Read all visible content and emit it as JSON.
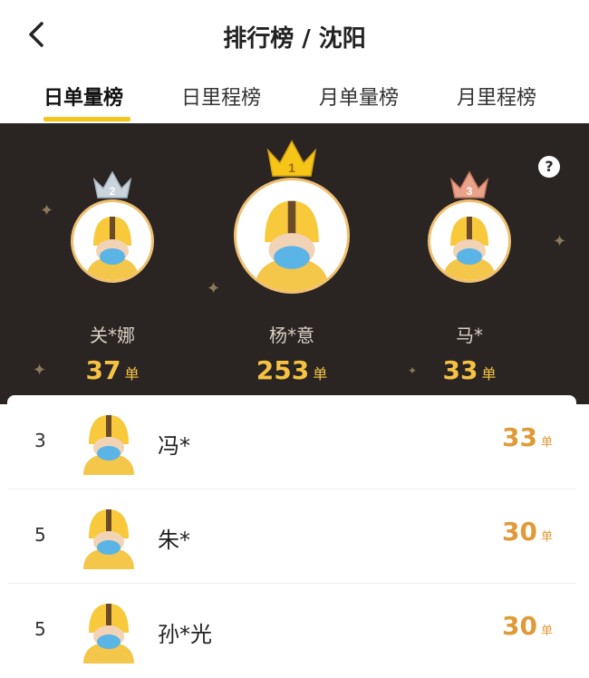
{
  "header": {
    "title": "排行榜 / 沈阳",
    "back_icon": "chevron-left-icon"
  },
  "tabs": [
    {
      "label": "日单量榜",
      "active": true
    },
    {
      "label": "日里程榜",
      "active": false
    },
    {
      "label": "月单量榜",
      "active": false
    },
    {
      "label": "月里程榜",
      "active": false
    }
  ],
  "podium": {
    "help_icon": "?",
    "first": {
      "rank": "1",
      "name": "杨*意",
      "count": "253",
      "unit": "单"
    },
    "second": {
      "rank": "2",
      "name": "关*娜",
      "count": "37",
      "unit": "单"
    },
    "third": {
      "rank": "3",
      "name": "马*",
      "count": "33",
      "unit": "单"
    }
  },
  "list": [
    {
      "rank": "3",
      "name": "冯*",
      "count": "33",
      "unit": "单"
    },
    {
      "rank": "5",
      "name": "朱*",
      "count": "30",
      "unit": "单"
    },
    {
      "rank": "5",
      "name": "孙*光",
      "count": "30",
      "unit": "单"
    }
  ],
  "colors": {
    "accent": "#f5c518",
    "podium_bg": "#2a2523",
    "count": "#f5c242",
    "list_count": "#e09a38"
  }
}
